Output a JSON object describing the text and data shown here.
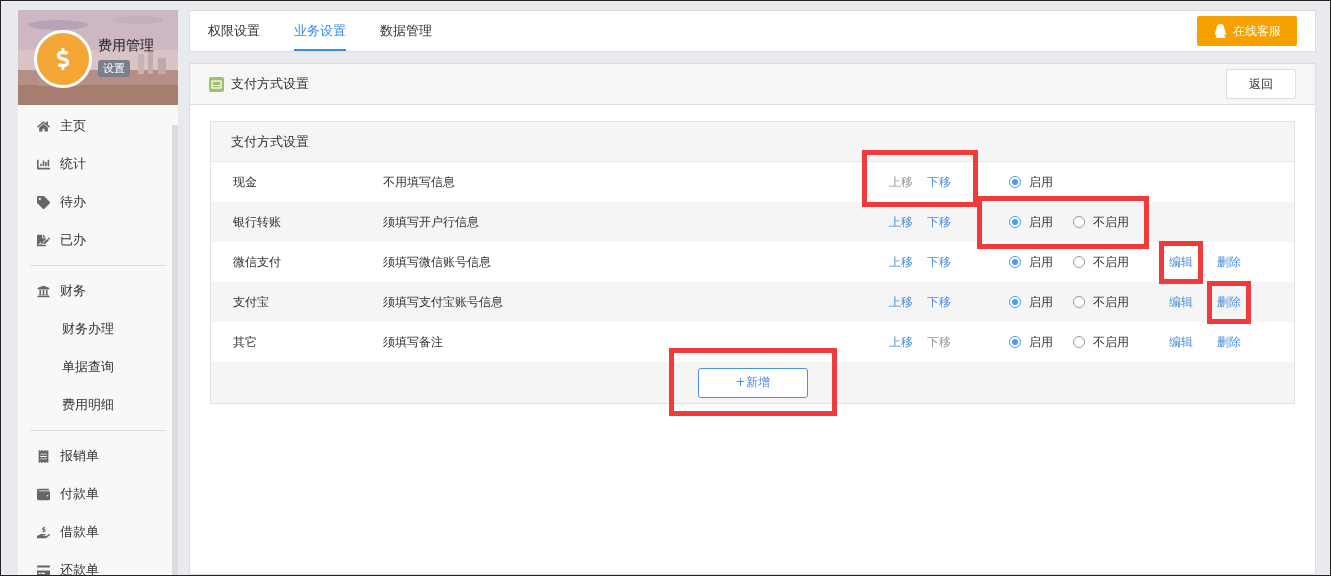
{
  "app": {
    "title": "费用管理",
    "badge": "设置"
  },
  "sidebar": {
    "groups": [
      [
        {
          "label": "主页"
        },
        {
          "label": "统计"
        },
        {
          "label": "待办"
        },
        {
          "label": "已办"
        }
      ],
      [
        {
          "label": "财务",
          "children": [
            {
              "label": "财务办理"
            },
            {
              "label": "单据查询"
            },
            {
              "label": "费用明细"
            }
          ]
        }
      ],
      [
        {
          "label": "报销单"
        },
        {
          "label": "付款单"
        },
        {
          "label": "借款单"
        },
        {
          "label": "还款单"
        }
      ]
    ]
  },
  "tabs": [
    {
      "label": "权限设置",
      "selected": false
    },
    {
      "label": "业务设置",
      "selected": true
    },
    {
      "label": "数据管理",
      "selected": false
    }
  ],
  "service_button": "在线客服",
  "panel": {
    "title": "支付方式设置",
    "back_button": "返回"
  },
  "card": {
    "title": "支付方式设置",
    "rows": [
      {
        "name": "现金",
        "description": "不用填写信息",
        "moves": [
          {
            "label": "上移",
            "disabled": true
          },
          {
            "label": "下移",
            "disabled": false
          }
        ],
        "moves_highlighted": true,
        "options": [
          {
            "label": "启用",
            "selected": true
          }
        ],
        "status_highlighted": false,
        "actions": []
      },
      {
        "name": "银行转账",
        "description": "须填写开户行信息",
        "moves": [
          {
            "label": "上移",
            "disabled": false
          },
          {
            "label": "下移",
            "disabled": false
          }
        ],
        "moves_highlighted": false,
        "options": [
          {
            "label": "启用",
            "selected": true
          },
          {
            "label": "不启用",
            "selected": false
          }
        ],
        "status_highlighted": true,
        "actions": []
      },
      {
        "name": "微信支付",
        "description": "须填写微信账号信息",
        "moves": [
          {
            "label": "上移",
            "disabled": false
          },
          {
            "label": "下移",
            "disabled": false
          }
        ],
        "moves_highlighted": false,
        "options": [
          {
            "label": "启用",
            "selected": true
          },
          {
            "label": "不启用",
            "selected": false
          }
        ],
        "status_highlighted": false,
        "actions": [
          {
            "label": "编辑",
            "highlighted": true
          },
          {
            "label": "删除",
            "highlighted": false
          }
        ]
      },
      {
        "name": "支付宝",
        "description": "须填写支付宝账号信息",
        "moves": [
          {
            "label": "上移",
            "disabled": false
          },
          {
            "label": "下移",
            "disabled": false
          }
        ],
        "moves_highlighted": false,
        "options": [
          {
            "label": "启用",
            "selected": true
          },
          {
            "label": "不启用",
            "selected": false
          }
        ],
        "status_highlighted": false,
        "actions": [
          {
            "label": "编辑",
            "highlighted": false
          },
          {
            "label": "删除",
            "highlighted": true
          }
        ]
      },
      {
        "name": "其它",
        "description": "须填写备注",
        "moves": [
          {
            "label": "上移",
            "disabled": false
          },
          {
            "label": "下移",
            "disabled": true
          }
        ],
        "moves_highlighted": false,
        "options": [
          {
            "label": "启用",
            "selected": true
          },
          {
            "label": "不启用",
            "selected": false
          }
        ],
        "status_highlighted": false,
        "actions": [
          {
            "label": "编辑",
            "highlighted": false
          },
          {
            "label": "删除",
            "highlighted": false
          }
        ]
      }
    ],
    "add_button": {
      "label": "+新增",
      "highlighted": true
    }
  }
}
